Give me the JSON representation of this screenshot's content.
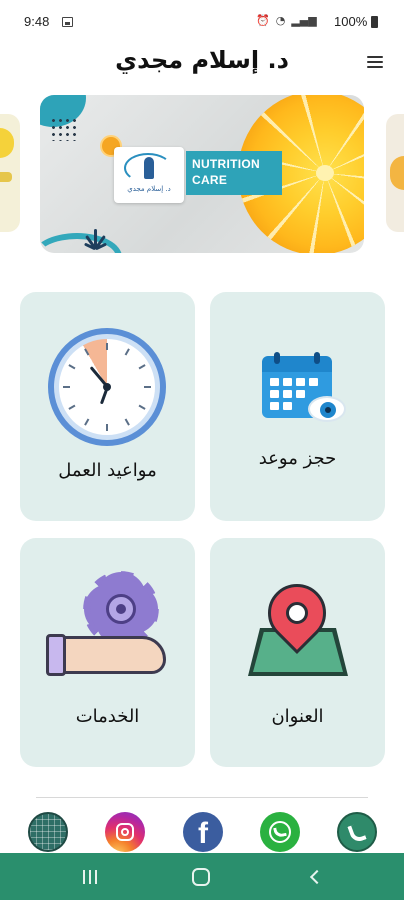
{
  "status_bar": {
    "time": "9:48",
    "battery": "100%"
  },
  "header": {
    "title": "د. إسلام مجدي"
  },
  "banner": {
    "badge_line1": "NUTRITION",
    "badge_line2": "CARE",
    "logo_text": "د. إسلام مجدي"
  },
  "tiles": [
    {
      "label": "حجز موعد",
      "icon": "calendar-eye-icon"
    },
    {
      "label": "مواعيد العمل",
      "icon": "clock-icon"
    },
    {
      "label": "العنوان",
      "icon": "map-pin-icon"
    },
    {
      "label": "الخدمات",
      "icon": "gear-hand-icon"
    }
  ],
  "social": [
    "website-icon",
    "instagram-icon",
    "facebook-icon",
    "whatsapp-icon",
    "phone-icon"
  ],
  "social_labels": {
    "facebook": "f"
  },
  "colors": {
    "tile_bg": "#e0eeec",
    "navbar": "#2a8f6d",
    "accent_teal": "#2ea3b8"
  }
}
